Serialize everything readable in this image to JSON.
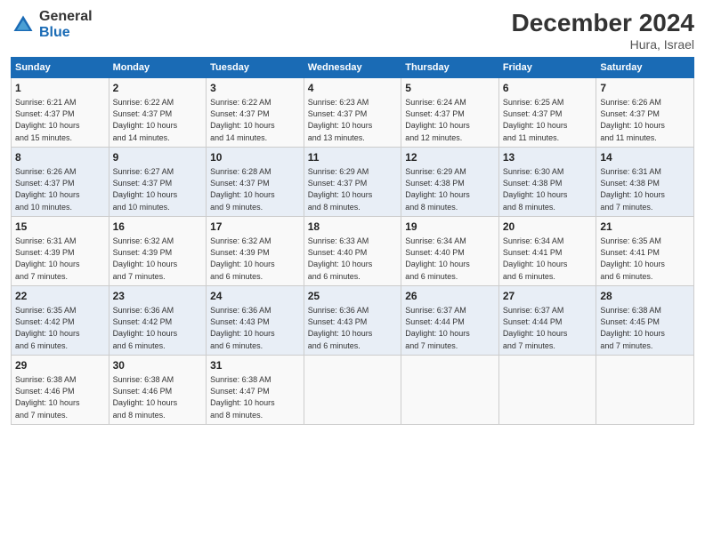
{
  "logo": {
    "general": "General",
    "blue": "Blue"
  },
  "title": "December 2024",
  "location": "Hura, Israel",
  "days_of_week": [
    "Sunday",
    "Monday",
    "Tuesday",
    "Wednesday",
    "Thursday",
    "Friday",
    "Saturday"
  ],
  "weeks": [
    [
      {
        "day": "1",
        "info": "Sunrise: 6:21 AM\nSunset: 4:37 PM\nDaylight: 10 hours\nand 15 minutes."
      },
      {
        "day": "2",
        "info": "Sunrise: 6:22 AM\nSunset: 4:37 PM\nDaylight: 10 hours\nand 14 minutes."
      },
      {
        "day": "3",
        "info": "Sunrise: 6:22 AM\nSunset: 4:37 PM\nDaylight: 10 hours\nand 14 minutes."
      },
      {
        "day": "4",
        "info": "Sunrise: 6:23 AM\nSunset: 4:37 PM\nDaylight: 10 hours\nand 13 minutes."
      },
      {
        "day": "5",
        "info": "Sunrise: 6:24 AM\nSunset: 4:37 PM\nDaylight: 10 hours\nand 12 minutes."
      },
      {
        "day": "6",
        "info": "Sunrise: 6:25 AM\nSunset: 4:37 PM\nDaylight: 10 hours\nand 11 minutes."
      },
      {
        "day": "7",
        "info": "Sunrise: 6:26 AM\nSunset: 4:37 PM\nDaylight: 10 hours\nand 11 minutes."
      }
    ],
    [
      {
        "day": "8",
        "info": "Sunrise: 6:26 AM\nSunset: 4:37 PM\nDaylight: 10 hours\nand 10 minutes."
      },
      {
        "day": "9",
        "info": "Sunrise: 6:27 AM\nSunset: 4:37 PM\nDaylight: 10 hours\nand 10 minutes."
      },
      {
        "day": "10",
        "info": "Sunrise: 6:28 AM\nSunset: 4:37 PM\nDaylight: 10 hours\nand 9 minutes."
      },
      {
        "day": "11",
        "info": "Sunrise: 6:29 AM\nSunset: 4:37 PM\nDaylight: 10 hours\nand 8 minutes."
      },
      {
        "day": "12",
        "info": "Sunrise: 6:29 AM\nSunset: 4:38 PM\nDaylight: 10 hours\nand 8 minutes."
      },
      {
        "day": "13",
        "info": "Sunrise: 6:30 AM\nSunset: 4:38 PM\nDaylight: 10 hours\nand 8 minutes."
      },
      {
        "day": "14",
        "info": "Sunrise: 6:31 AM\nSunset: 4:38 PM\nDaylight: 10 hours\nand 7 minutes."
      }
    ],
    [
      {
        "day": "15",
        "info": "Sunrise: 6:31 AM\nSunset: 4:39 PM\nDaylight: 10 hours\nand 7 minutes."
      },
      {
        "day": "16",
        "info": "Sunrise: 6:32 AM\nSunset: 4:39 PM\nDaylight: 10 hours\nand 7 minutes."
      },
      {
        "day": "17",
        "info": "Sunrise: 6:32 AM\nSunset: 4:39 PM\nDaylight: 10 hours\nand 6 minutes."
      },
      {
        "day": "18",
        "info": "Sunrise: 6:33 AM\nSunset: 4:40 PM\nDaylight: 10 hours\nand 6 minutes."
      },
      {
        "day": "19",
        "info": "Sunrise: 6:34 AM\nSunset: 4:40 PM\nDaylight: 10 hours\nand 6 minutes."
      },
      {
        "day": "20",
        "info": "Sunrise: 6:34 AM\nSunset: 4:41 PM\nDaylight: 10 hours\nand 6 minutes."
      },
      {
        "day": "21",
        "info": "Sunrise: 6:35 AM\nSunset: 4:41 PM\nDaylight: 10 hours\nand 6 minutes."
      }
    ],
    [
      {
        "day": "22",
        "info": "Sunrise: 6:35 AM\nSunset: 4:42 PM\nDaylight: 10 hours\nand 6 minutes."
      },
      {
        "day": "23",
        "info": "Sunrise: 6:36 AM\nSunset: 4:42 PM\nDaylight: 10 hours\nand 6 minutes."
      },
      {
        "day": "24",
        "info": "Sunrise: 6:36 AM\nSunset: 4:43 PM\nDaylight: 10 hours\nand 6 minutes."
      },
      {
        "day": "25",
        "info": "Sunrise: 6:36 AM\nSunset: 4:43 PM\nDaylight: 10 hours\nand 6 minutes."
      },
      {
        "day": "26",
        "info": "Sunrise: 6:37 AM\nSunset: 4:44 PM\nDaylight: 10 hours\nand 7 minutes."
      },
      {
        "day": "27",
        "info": "Sunrise: 6:37 AM\nSunset: 4:44 PM\nDaylight: 10 hours\nand 7 minutes."
      },
      {
        "day": "28",
        "info": "Sunrise: 6:38 AM\nSunset: 4:45 PM\nDaylight: 10 hours\nand 7 minutes."
      }
    ],
    [
      {
        "day": "29",
        "info": "Sunrise: 6:38 AM\nSunset: 4:46 PM\nDaylight: 10 hours\nand 7 minutes."
      },
      {
        "day": "30",
        "info": "Sunrise: 6:38 AM\nSunset: 4:46 PM\nDaylight: 10 hours\nand 8 minutes."
      },
      {
        "day": "31",
        "info": "Sunrise: 6:38 AM\nSunset: 4:47 PM\nDaylight: 10 hours\nand 8 minutes."
      },
      {
        "day": "",
        "info": ""
      },
      {
        "day": "",
        "info": ""
      },
      {
        "day": "",
        "info": ""
      },
      {
        "day": "",
        "info": ""
      }
    ]
  ]
}
